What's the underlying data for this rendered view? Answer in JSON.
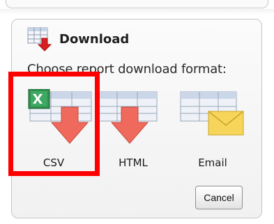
{
  "dialog": {
    "title": "Download",
    "prompt": "Choose report download format:",
    "options": [
      {
        "label": "CSV",
        "icon": "csv-download-icon"
      },
      {
        "label": "HTML",
        "icon": "html-download-icon"
      },
      {
        "label": "Email",
        "icon": "email-icon"
      }
    ],
    "cancel_label": "Cancel"
  },
  "colors": {
    "highlight": "#ff0000",
    "arrow": "#ef6a5d",
    "envelope": "#f6d55a",
    "excel_green": "#1f7a3d"
  }
}
